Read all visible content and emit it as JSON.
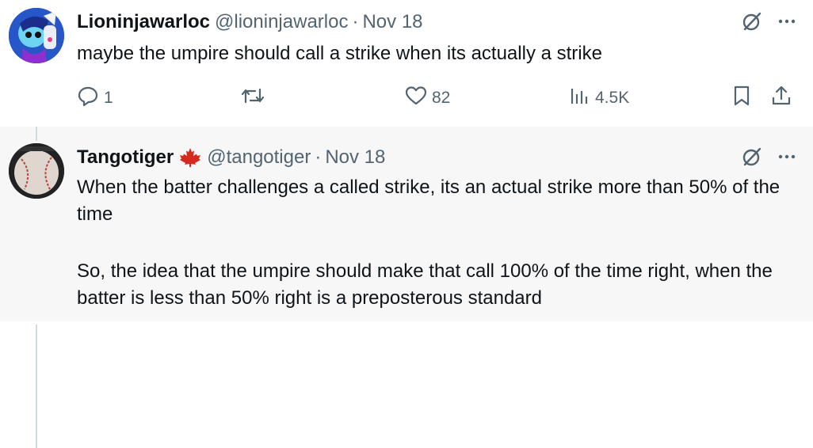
{
  "tweets": [
    {
      "display_name": "Lioninjawarloc",
      "handle": "@lioninjawarloc",
      "separator": "·",
      "date": "Nov 18",
      "text": "maybe the umpire should call a strike when its actually a strike",
      "replies": "1",
      "likes": "82",
      "views": "4.5K"
    },
    {
      "display_name": "Tangotiger",
      "handle": "@tangotiger",
      "separator": "·",
      "date": "Nov 18",
      "paragraphs": [
        "When the batter challenges a called strike, its an actual strike more than 50% of the time",
        "So, the idea that the umpire should make that call 100% of the time right, when the batter is less than 50% right is a preposterous standard"
      ]
    }
  ],
  "colors": {
    "text": "#0f1419",
    "muted": "#536471",
    "flag_red": "#d52b1e",
    "thread_line": "#cfd9de"
  },
  "icons": [
    "grok-icon",
    "more-icon",
    "reply-icon",
    "retweet-icon",
    "like-icon",
    "views-icon",
    "bookmark-icon",
    "share-icon",
    "canada-flag-icon"
  ]
}
